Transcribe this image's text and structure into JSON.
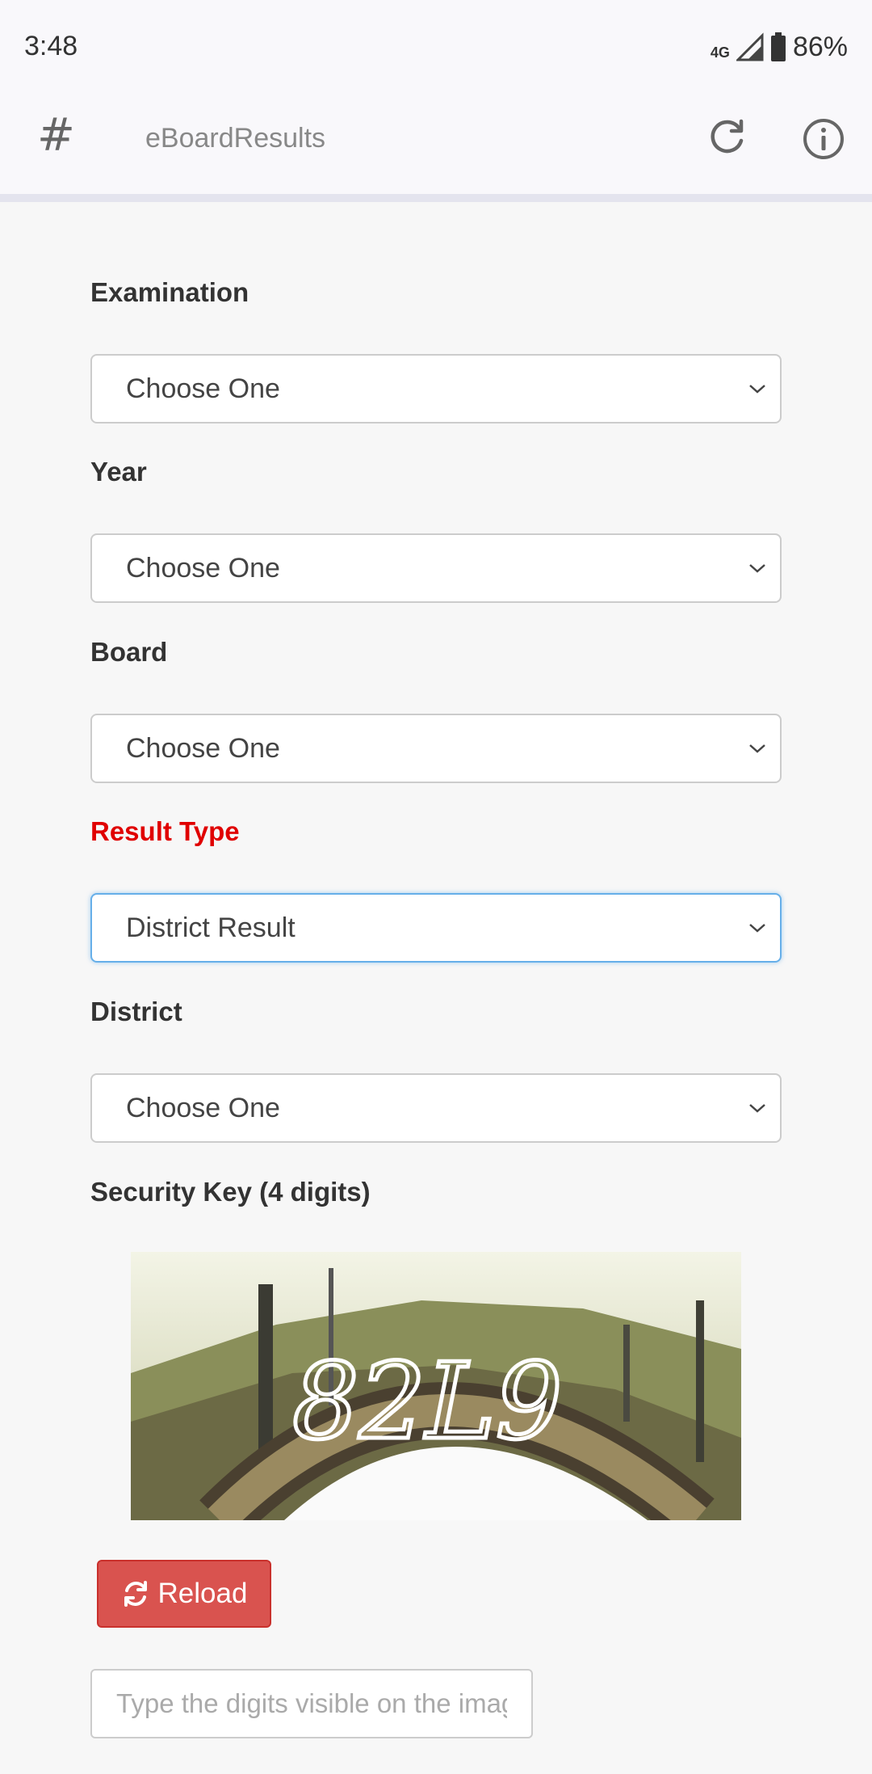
{
  "status_bar": {
    "time": "3:48",
    "network": "4G",
    "battery": "86%"
  },
  "app_bar": {
    "icon": "hash-icon",
    "title": "eBoardResults",
    "actions": [
      "refresh-icon",
      "info-icon"
    ]
  },
  "form": {
    "fields": [
      {
        "label": "Examination",
        "value": "Choose One"
      },
      {
        "label": "Year",
        "value": "Choose One"
      },
      {
        "label": "Board",
        "value": "Choose One"
      },
      {
        "label": "Result Type",
        "value": "District Result"
      },
      {
        "label": "District",
        "value": "Choose One"
      }
    ],
    "security_key_label": "Security Key (4 digits)",
    "reload_label": "Reload",
    "digits_placeholder": "Type the digits visible on the image"
  },
  "colors": {
    "alert_label": "#e00000",
    "reload_button": "#d9534f",
    "focus_border": "#66afe9"
  }
}
